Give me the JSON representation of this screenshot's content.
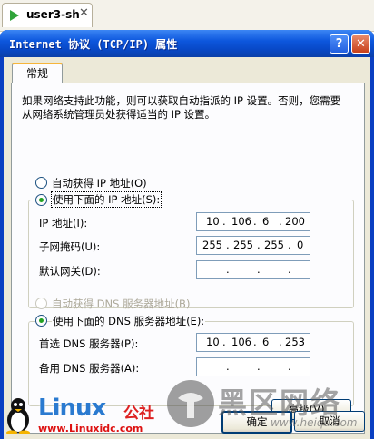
{
  "bg_tab": {
    "title": "user3-sh",
    "close": "✕"
  },
  "dialog": {
    "title": "Internet 协议 (TCP/IP) 属性",
    "help": "?",
    "close": "✕",
    "tab": "常规",
    "description": "如果网络支持此功能，则可以获取自动指派的 IP 设置。否则，您需要从网络系统管理员处获得适当的 IP 设置。",
    "ip_section": {
      "auto_label": "自动获得 IP 地址(O)",
      "auto_selected": false,
      "manual_label": "使用下面的 IP 地址(S):",
      "manual_selected": true,
      "fields": [
        {
          "label": "IP 地址(I):",
          "octets": [
            "10",
            "106",
            "6",
            "200"
          ]
        },
        {
          "label": "子网掩码(U):",
          "octets": [
            "255",
            "255",
            "255",
            "0"
          ]
        },
        {
          "label": "默认网关(D):",
          "octets": [
            "",
            "",
            "",
            ""
          ]
        }
      ]
    },
    "dns_section": {
      "auto_label": "自动获得 DNS 服务器地址(B)",
      "auto_enabled": false,
      "manual_label": "使用下面的 DNS 服务器地址(E):",
      "manual_selected": true,
      "fields": [
        {
          "label": "首选 DNS 服务器(P):",
          "octets": [
            "10",
            "106",
            "6",
            "253"
          ]
        },
        {
          "label": "备用 DNS 服务器(A):",
          "octets": [
            "",
            "",
            "",
            ""
          ]
        }
      ]
    },
    "buttons": {
      "advanced": "高级(V)...",
      "ok": "确定",
      "cancel": "取消"
    }
  },
  "watermarks": {
    "linux_text": "Linux",
    "linux_cn": "公社",
    "linux_url": "www.Linuxidc.com",
    "heiqu_text": "黑区网络",
    "heiqu_url": "www.heiqu.com"
  },
  "colors": {
    "titlebar": "#0d57dd",
    "window_bg": "#ece9d8",
    "radio_on": "#21a121",
    "tab_accent": "#f6b53b"
  }
}
